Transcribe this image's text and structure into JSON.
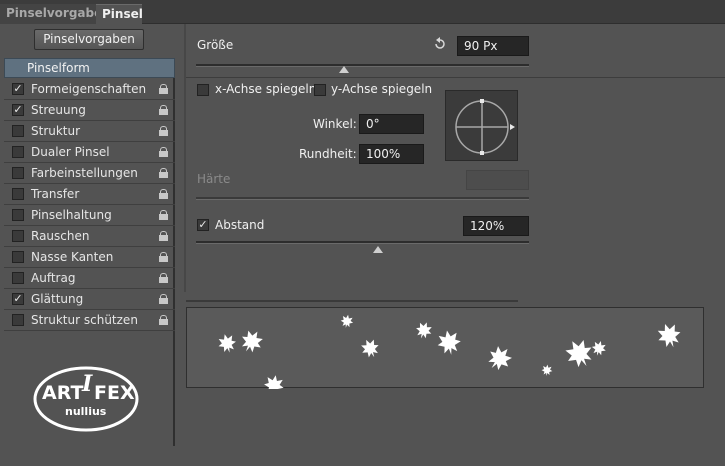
{
  "tabs": [
    {
      "label": "Pinselvorgaben",
      "active": false
    },
    {
      "label": "Pinsel",
      "active": true
    }
  ],
  "preset_button": "Pinselvorgaben",
  "left_list": {
    "header": "Pinselform",
    "items": [
      {
        "label": "Formeigenschaften",
        "checked": true
      },
      {
        "label": "Streuung",
        "checked": true
      },
      {
        "label": "Struktur",
        "checked": false
      },
      {
        "label": "Dualer Pinsel",
        "checked": false
      },
      {
        "label": "Farbeinstellungen",
        "checked": false
      },
      {
        "label": "Transfer",
        "checked": false
      },
      {
        "label": "Pinselhaltung",
        "checked": false
      },
      {
        "label": "Rauschen",
        "checked": false
      },
      {
        "label": "Nasse Kanten",
        "checked": false
      },
      {
        "label": "Auftrag",
        "checked": false
      },
      {
        "label": "Glättung",
        "checked": true
      },
      {
        "label": "Struktur schützen",
        "checked": false
      }
    ]
  },
  "logo": {
    "text_top": "ARTIFEX",
    "text_bottom": "nullius",
    "top_left": "ART",
    "top_i": "I",
    "top_right": "FEX"
  },
  "size": {
    "label": "Größe",
    "value": "90 Px",
    "slider_fraction": 0.45
  },
  "flip": {
    "x_label": "x-Achse spiegeln",
    "x_checked": false,
    "y_label": "y-Achse spiegeln",
    "y_checked": false
  },
  "angle": {
    "label": "Winkel:",
    "value": "0°"
  },
  "roundness": {
    "label": "Rundheit:",
    "value": "100%"
  },
  "hardness": {
    "label": "Härte",
    "value": ""
  },
  "spacing": {
    "label": "Abstand",
    "checked": true,
    "value": "120%",
    "slider_fraction": 0.55
  },
  "colors": {
    "bg": "#535353",
    "accent_header": "#5f7180",
    "field": "#262626"
  }
}
